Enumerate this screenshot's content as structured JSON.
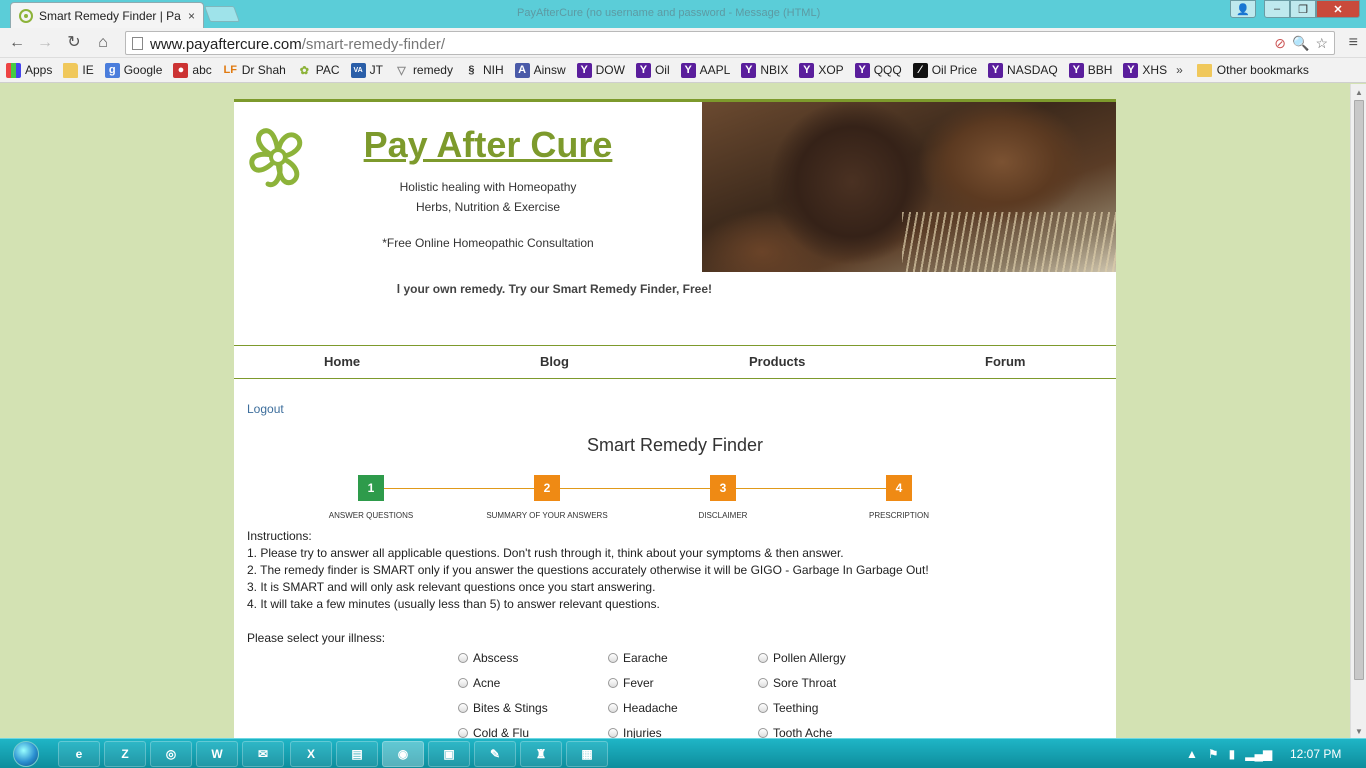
{
  "browser": {
    "tab_title": "Smart Remedy Finder | Pa",
    "tab_close": "×",
    "window_title": "PayAfterCure (no username and password - Message (HTML)",
    "url_host": "www.payaftercure.com",
    "url_path": "/smart-remedy-finder/",
    "bookmarks": [
      {
        "label": "Apps",
        "icon": "apps-grid-icon"
      },
      {
        "label": "IE",
        "icon": "folder-icon"
      },
      {
        "label": "Google",
        "icon": "google-icon"
      },
      {
        "label": "abc",
        "icon": "abc-icon"
      },
      {
        "label": "Dr Shah",
        "icon": "lf-icon"
      },
      {
        "label": "PAC",
        "icon": "pac-icon"
      },
      {
        "label": "JT",
        "icon": "va-tax-icon"
      },
      {
        "label": "remedy",
        "icon": "remedy-icon"
      },
      {
        "label": "NIH",
        "icon": "nih-icon"
      },
      {
        "label": "Ainsw",
        "icon": "ainsw-icon"
      },
      {
        "label": "DOW",
        "icon": "yahoo-icon"
      },
      {
        "label": "Oil",
        "icon": "yahoo-icon"
      },
      {
        "label": "AAPL",
        "icon": "yahoo-icon"
      },
      {
        "label": "NBIX",
        "icon": "yahoo-icon"
      },
      {
        "label": "XOP",
        "icon": "yahoo-icon"
      },
      {
        "label": "QQQ",
        "icon": "yahoo-icon"
      },
      {
        "label": "Oil Price",
        "icon": "oilprice-icon"
      },
      {
        "label": "NASDAQ",
        "icon": "yahoo-icon"
      },
      {
        "label": "BBH",
        "icon": "yahoo-icon"
      },
      {
        "label": "XHS",
        "icon": "yahoo-icon"
      }
    ],
    "bookmarks_more": "»",
    "other_bookmarks": "Other bookmarks"
  },
  "site": {
    "title": "Pay After Cure",
    "tagline_1": "Holistic healing with Homeopathy",
    "tagline_2": "Herbs, Nutrition & Exercise",
    "tagline_3": "*Free Online Homeopathic Consultation",
    "promo": "l your own remedy. Try our Smart Remedy Finder, Free!",
    "nav": [
      "Home",
      "Blog",
      "Products",
      "Forum"
    ],
    "logout": "Logout"
  },
  "finder": {
    "title": "Smart Remedy Finder",
    "steps": [
      {
        "num": "1",
        "label": "Answer Questions",
        "state": "active"
      },
      {
        "num": "2",
        "label": "Summary of your answers",
        "state": "todo"
      },
      {
        "num": "3",
        "label": "Disclaimer",
        "state": "todo"
      },
      {
        "num": "4",
        "label": "Prescription",
        "state": "todo"
      }
    ],
    "instructions_heading": "Instructions:",
    "instructions": [
      "1. Please try to answer all applicable questions. Don't rush through it, think about your symptoms & then answer.",
      "2. The remedy finder is SMART only if you answer the questions accurately otherwise it will be GIGO - Garbage In Garbage Out!",
      "3. It is SMART and will only ask relevant questions once you start answering.",
      "4. It will take a few minutes (usually less than 5) to answer relevant questions."
    ],
    "select_label": "Please select your illness:",
    "illness_columns": [
      [
        "Abscess",
        "Acne",
        "Bites & Stings",
        "Cold & Flu"
      ],
      [
        "Earache",
        "Fever",
        "Headache",
        "Injuries"
      ],
      [
        "Pollen Allergy",
        "Sore Throat",
        "Teething",
        "Tooth Ache"
      ]
    ]
  },
  "taskbar": {
    "clock": "12:07 PM"
  },
  "colors": {
    "brand_green": "#7d9a2c",
    "step_active": "#2e9b4b",
    "step_todo": "#ef8a14",
    "page_bg": "#d3e2b3"
  }
}
